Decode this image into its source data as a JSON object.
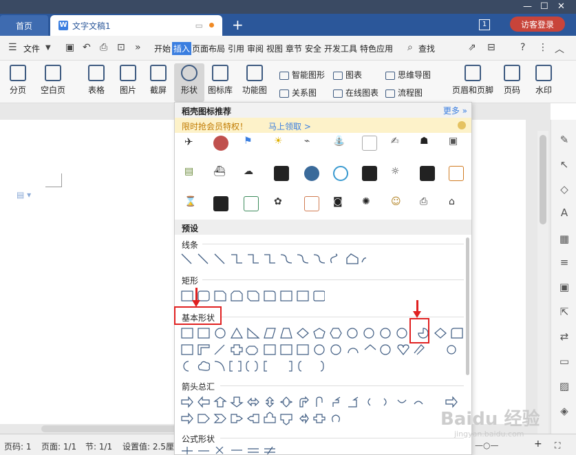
{
  "titlebar": {
    "tab_home": "首页",
    "tab_doc": "文字文稿1",
    "badge": "1",
    "visitor_login": "访客登录"
  },
  "menubar": {
    "file": "文件",
    "items": [
      "开始",
      "插入",
      "页面布局",
      "引用",
      "审阅",
      "视图",
      "章节",
      "安全",
      "开发工具",
      "特色应用"
    ],
    "active": "插入",
    "search": "查找"
  },
  "ribbon": {
    "section_break": "分页",
    "blank_page": "空白页",
    "table": "表格",
    "picture": "图片",
    "screenshot": "截屏",
    "shape": "形状",
    "icon_library": "图标库",
    "function_chart": "功能图",
    "smart_art": "智能图形",
    "chart": "图表",
    "mind_map": "思维导图",
    "relation_chart": "关系图",
    "online_chart": "在线图表",
    "flowchart": "流程图",
    "header_footer": "页眉和页脚",
    "page_number": "页码",
    "watermark": "水印"
  },
  "panel": {
    "title": "稻壳图标推荐",
    "more": "更多",
    "promo_text": "限时抢会员特权！",
    "promo_link": "马上领取 >",
    "preset": "预设",
    "groups": {
      "lines": "线条",
      "rect": "矩形",
      "basic": "基本形状",
      "arrows": "箭头总汇",
      "formula": "公式形状"
    }
  },
  "status": {
    "page_no": "页码: 1",
    "pages": "页面: 1/1",
    "section": "节: 1/1",
    "setting": "设置值: 2.5厘"
  },
  "watermark": {
    "brand": "Baidu 经验",
    "url": "jingyan.baidu.com"
  }
}
